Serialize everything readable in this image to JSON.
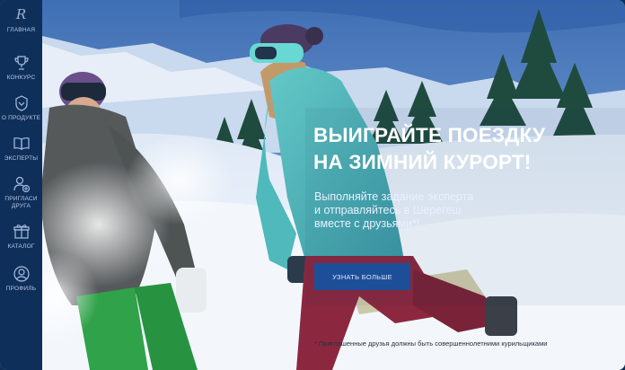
{
  "sidebar": {
    "logo_mark": "R",
    "items": [
      {
        "label": "ГЛАВНАЯ",
        "icon": "logo-r-icon"
      },
      {
        "label": "КОНКУРС",
        "icon": "trophy-icon"
      },
      {
        "label": "О ПРОДУКТЕ",
        "icon": "product-badge-icon"
      },
      {
        "label": "ЭКСПЕРТЫ",
        "icon": "book-icon"
      },
      {
        "label_line1": "ПРИГЛАСИ",
        "label_line2": "ДРУГА",
        "icon": "invite-friend-icon"
      },
      {
        "label": "КАТАЛОГ",
        "icon": "gift-icon"
      },
      {
        "label": "ПРОФИЛЬ",
        "icon": "user-icon"
      }
    ]
  },
  "hero": {
    "headline_line1": "ВЫИГРАЙТЕ ПОЕЗДКУ",
    "headline_line2": "НА ЗИМНИЙ КУРОРТ!",
    "subtext_line1": "Выполняйте задание эксперта",
    "subtext_line2": "и отправляйтесь в Шерегеш",
    "subtext_line3": "вместе с друзьями*!",
    "cta_label": "УЗНАТЬ БОЛЬШЕ",
    "footnote": "* Приглашенные друзья должны быть совершеннолетними курильщиками"
  },
  "colors": {
    "sidebar_bg": "#0f2f5b",
    "sidebar_text": "#b9c8e0",
    "cta_bg": "#1d4f98",
    "headline": "#ffffff"
  }
}
